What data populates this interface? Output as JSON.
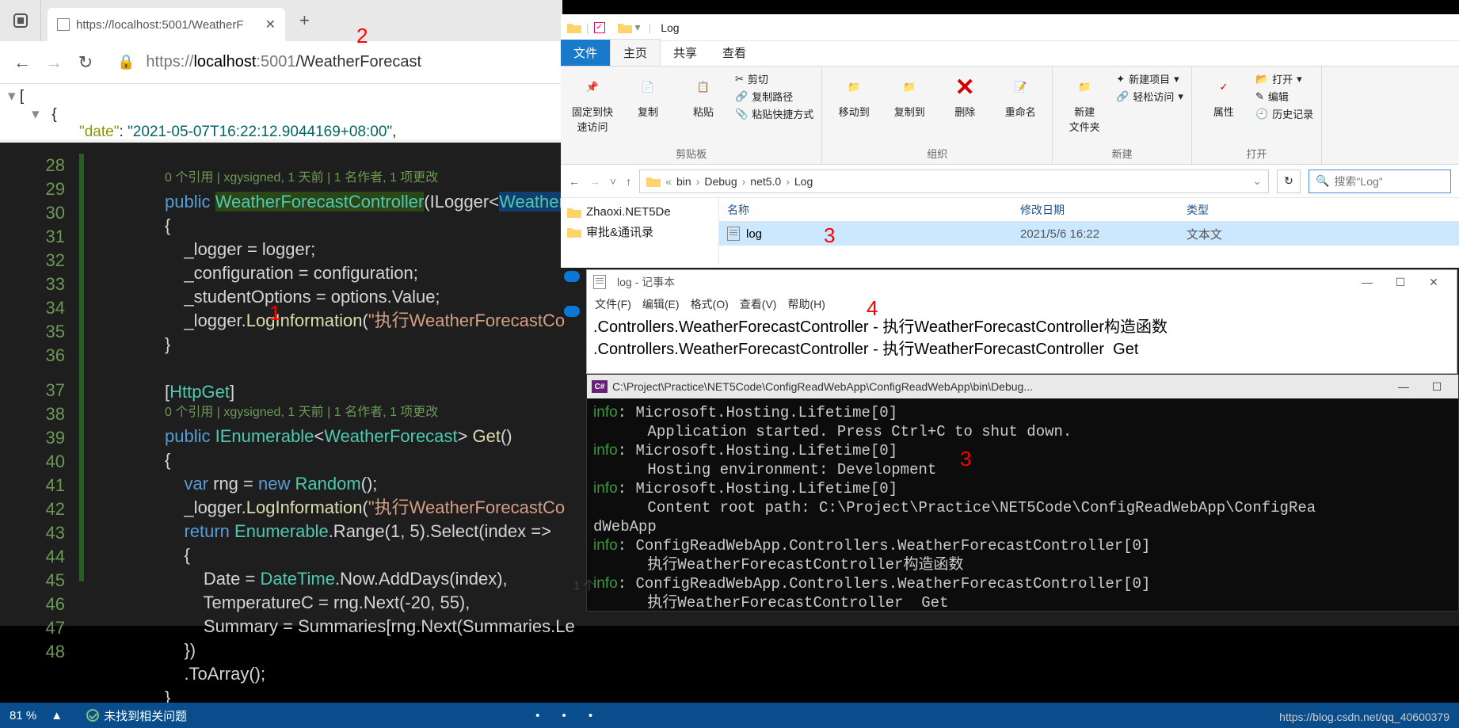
{
  "browser": {
    "tab_title": "https://localhost:5001/WeatherF",
    "url_prefix": "https://",
    "url_host": "localhost",
    "url_port": ":5001",
    "url_path": "/WeatherForecast",
    "json_line1a": "{",
    "json_key": "\"date\"",
    "json_colon": ": ",
    "json_val": "\"2021-05-07T16:22:12.9044169+08:00\"",
    "json_comma": ","
  },
  "editor": {
    "lines_start": 28,
    "lines_end": 48,
    "codelens1": "0 个引用 | xgysigned, 1 天前 | 1 名作者, 1 项更改",
    "codelens2": "0 个引用 | xgysigned, 1 天前 | 1 名作者, 1 项更改",
    "code": {
      "l28a": "public ",
      "l28b": "WeatherForecastController",
      "l28c": "(ILogger<",
      "l28d": "WeatherF",
      "l29": "{",
      "l30": "    _logger = logger;",
      "l31": "    _configuration = configuration;",
      "l32": "    _studentOptions = options.Value;",
      "l33a": "    _logger.",
      "l33b": "LogInformation",
      "l33c": "(",
      "l33d": "\"执行WeatherForecastCo",
      "l34": "}",
      "l36a": "[",
      "l36b": "HttpGet",
      "l36c": "]",
      "l37a": "public ",
      "l37b": "IEnumerable",
      "l37c": "<",
      "l37d": "WeatherForecast",
      "l37e": "> ",
      "l37f": "Get",
      "l37g": "()",
      "l38": "{",
      "l39a": "    var ",
      "l39b": "rng = ",
      "l39c": "new ",
      "l39d": "Random",
      "l39e": "();",
      "l40a": "    _logger.",
      "l40b": "LogInformation",
      "l40c": "(",
      "l40d": "\"执行WeatherForecastCo",
      "l41a": "    return ",
      "l41b": "Enumerable",
      "l41c": ".Range(1, 5).Select(index =>",
      "l42": "    {",
      "l43a": "        Date = ",
      "l43b": "DateTime",
      "l43c": ".Now.AddDays(index),",
      "l44": "        TemperatureC = rng.Next(-20, 55),",
      "l45": "        Summary = Summaries[rng.Next(Summaries.Le",
      "l46": "    })",
      "l47": "    .ToArray();",
      "l48": "}"
    },
    "status_zoom": "81 %",
    "status_msg": "未找到相关问题"
  },
  "explorer": {
    "title_app": "Log",
    "ribbon_tabs": {
      "file": "文件",
      "home": "主页",
      "share": "共享",
      "view": "查看"
    },
    "ribbon": {
      "pin": "固定到快\n速访问",
      "copy": "复制",
      "paste": "粘贴",
      "cut": "剪切",
      "copypath": "复制路径",
      "pasteshortcut": "粘贴快捷方式",
      "moveto": "移动到",
      "copyto": "复制到",
      "delete": "删除",
      "rename": "重命名",
      "newfolder": "新建\n文件夹",
      "newitem": "新建项目",
      "easyaccess": "轻松访问",
      "properties": "属性",
      "open": "打开",
      "edit": "编辑",
      "history": "历史记录",
      "grp_clip": "剪贴板",
      "grp_org": "组织",
      "grp_new": "新建",
      "grp_open": "打开"
    },
    "path": {
      "crumbs": [
        "bin",
        "Debug",
        "net5.0",
        "Log"
      ],
      "prefix": "«"
    },
    "search_placeholder": "搜索\"Log\"",
    "nav_items": [
      "Zhaoxi.NET5De",
      "审批&通讯录"
    ],
    "columns": {
      "name": "名称",
      "date": "修改日期",
      "type": "类型"
    },
    "file": {
      "name": "log",
      "date": "2021/5/6 16:22",
      "type": "文本文"
    },
    "file_count": "1 个"
  },
  "notepad": {
    "title": "log - 记事本",
    "menu": [
      "文件(F)",
      "编辑(E)",
      "格式(O)",
      "查看(V)",
      "帮助(H)"
    ],
    "line1": ".Controllers.WeatherForecastController - 执行WeatherForecastController构造函数",
    "line2": ".Controllers.WeatherForecastController - 执行WeatherForecastController  Get"
  },
  "terminal": {
    "title": "C:\\Project\\Practice\\NET5Code\\ConfigReadWebApp\\ConfigReadWebApp\\bin\\Debug...",
    "lines": [
      {
        "p": "info",
        "t": ": Microsoft.Hosting.Lifetime[0]"
      },
      {
        "p": "",
        "t": "      Application started. Press Ctrl+C to shut down."
      },
      {
        "p": "info",
        "t": ": Microsoft.Hosting.Lifetime[0]"
      },
      {
        "p": "",
        "t": "      Hosting environment: Development"
      },
      {
        "p": "info",
        "t": ": Microsoft.Hosting.Lifetime[0]"
      },
      {
        "p": "",
        "t": "      Content root path: C:\\Project\\Practice\\NET5Code\\ConfigReadWebApp\\ConfigRea"
      },
      {
        "p": "",
        "t": "dWebApp"
      },
      {
        "p": "info",
        "t": ": ConfigReadWebApp.Controllers.WeatherForecastController[0]"
      },
      {
        "p": "",
        "t": "      执行WeatherForecastController构造函数"
      },
      {
        "p": "info",
        "t": ": ConfigReadWebApp.Controllers.WeatherForecastController[0]"
      },
      {
        "p": "",
        "t": "      执行WeatherForecastController  Get"
      }
    ]
  },
  "annotations": {
    "a1": "1",
    "a2": "2",
    "a3": "3",
    "a3b": "3",
    "a4": "4"
  },
  "watermark": "https://blog.csdn.net/qq_40600379"
}
